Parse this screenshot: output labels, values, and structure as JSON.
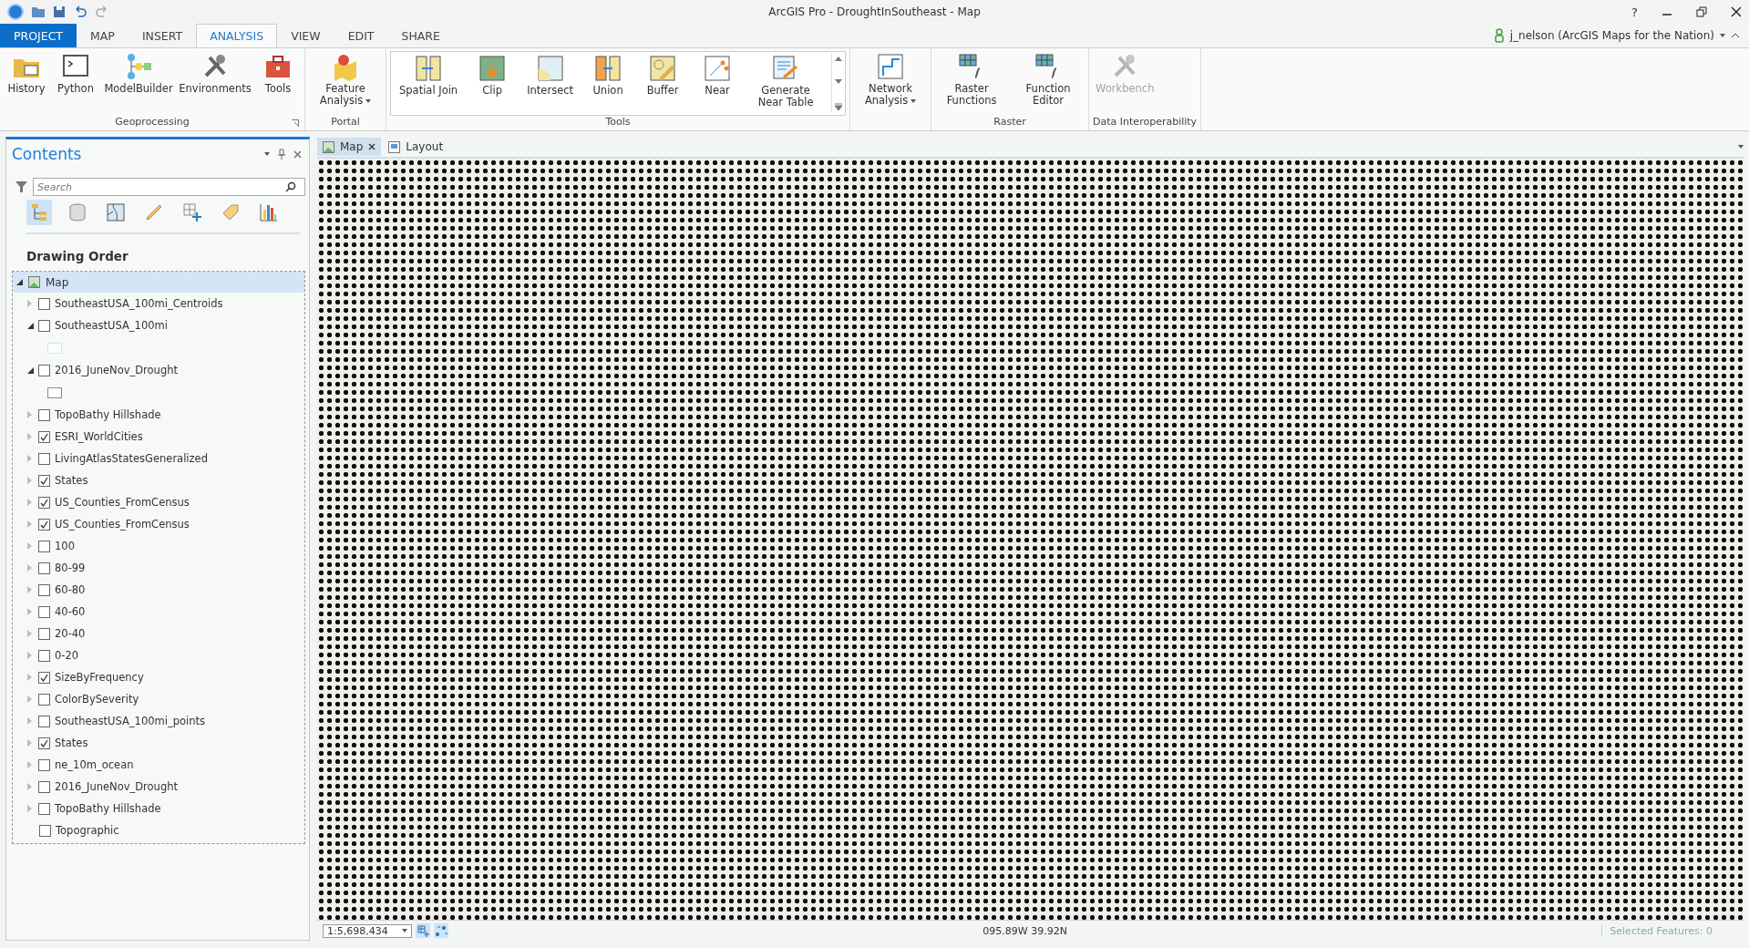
{
  "window": {
    "title": "ArcGIS Pro - DroughtInSoutheast - Map",
    "help": "?"
  },
  "user": {
    "name": "j_nelson (ArcGIS Maps for the Nation)"
  },
  "ribbon_tabs": [
    {
      "label": "PROJECT",
      "kind": "backstage",
      "selected": false
    },
    {
      "label": "MAP",
      "kind": "tab",
      "selected": false
    },
    {
      "label": "INSERT",
      "kind": "tab",
      "selected": false
    },
    {
      "label": "ANALYSIS",
      "kind": "tab",
      "selected": true
    },
    {
      "label": "VIEW",
      "kind": "tab",
      "selected": false
    },
    {
      "label": "EDIT",
      "kind": "tab",
      "selected": false
    },
    {
      "label": "SHARE",
      "kind": "tab",
      "selected": false
    }
  ],
  "ribbon_groups": [
    {
      "label": "Geoprocessing",
      "launcher": true,
      "tools": [
        {
          "label": "History"
        },
        {
          "label": "Python"
        },
        {
          "label": "ModelBuilder"
        },
        {
          "label": "Environments"
        },
        {
          "label": "Tools"
        }
      ]
    },
    {
      "label": "Portal",
      "tools": [
        {
          "label": "Feature Analysis",
          "menu": true
        }
      ]
    },
    {
      "label": "Tools",
      "gallery": true,
      "tools": [
        {
          "label": "Spatial Join"
        },
        {
          "label": "Clip"
        },
        {
          "label": "Intersect"
        },
        {
          "label": "Union"
        },
        {
          "label": "Buffer"
        },
        {
          "label": "Near"
        },
        {
          "label": "Generate Near Table"
        }
      ]
    },
    {
      "tools": [
        {
          "label": "Network Analysis",
          "menu": true
        }
      ]
    },
    {
      "label": "Raster",
      "tools": [
        {
          "label": "Raster Functions"
        },
        {
          "label": "Function Editor"
        }
      ]
    },
    {
      "label": "Data Interoperability",
      "tools": [
        {
          "label": "Workbench",
          "disabled": true
        }
      ]
    }
  ],
  "contents": {
    "title": "Contents",
    "search": {
      "placeholder": "Search"
    },
    "heading": "Drawing Order",
    "layers": [
      {
        "name": "Map",
        "kind": "map",
        "expanded": true,
        "selected": true,
        "children": [
          {
            "name": "SoutheastUSA_100mi_Centroids",
            "kind": "layer",
            "checked": false,
            "expanded": false
          },
          {
            "name": "SoutheastUSA_100mi",
            "kind": "layer",
            "checked": false,
            "expanded": true,
            "color": "#b8f0f4"
          },
          {
            "name": "2016_JuneNov_Drought",
            "kind": "layer",
            "checked": false,
            "expanded": true,
            "color": "#8a8a8a"
          },
          {
            "name": "TopoBathy Hillshade",
            "kind": "layer",
            "checked": false,
            "expanded": false
          },
          {
            "name": "ESRI_WorldCities",
            "kind": "layer",
            "checked": true,
            "expanded": false
          },
          {
            "name": "LivingAtlasStatesGeneralized",
            "kind": "layer",
            "checked": false,
            "expanded": false
          },
          {
            "name": "States",
            "kind": "layer",
            "checked": true,
            "expanded": false
          },
          {
            "name": "US_Counties_FromCensus",
            "kind": "layer",
            "checked": true,
            "expanded": false
          },
          {
            "name": "US_Counties_FromCensus",
            "kind": "layer",
            "checked": true,
            "expanded": false
          },
          {
            "name": "100",
            "kind": "layer",
            "checked": false,
            "expanded": false
          },
          {
            "name": "80-99",
            "kind": "layer",
            "checked": false,
            "expanded": false
          },
          {
            "name": "60-80",
            "kind": "layer",
            "checked": false,
            "expanded": false
          },
          {
            "name": "40-60",
            "kind": "layer",
            "checked": false,
            "expanded": false
          },
          {
            "name": "20-40",
            "kind": "layer",
            "checked": false,
            "expanded": false
          },
          {
            "name": "0-20",
            "kind": "layer",
            "checked": false,
            "expanded": false
          },
          {
            "name": "SizeByFrequency",
            "kind": "layer",
            "checked": true,
            "expanded": false
          },
          {
            "name": "ColorBySeverity",
            "kind": "layer",
            "checked": false,
            "expanded": false
          },
          {
            "name": "SoutheastUSA_100mi_points",
            "kind": "layer",
            "checked": false,
            "expanded": false
          },
          {
            "name": "States",
            "kind": "layer",
            "checked": true,
            "expanded": false
          },
          {
            "name": "ne_10m_ocean",
            "kind": "layer",
            "checked": false,
            "expanded": false
          },
          {
            "name": "2016_JuneNov_Drought",
            "kind": "layer",
            "checked": false,
            "expanded": false
          },
          {
            "name": "TopoBathy Hillshade",
            "kind": "layer",
            "checked": false,
            "expanded": false
          },
          {
            "name": "Topographic",
            "kind": "basemap",
            "checked": false
          }
        ]
      }
    ]
  },
  "view_tabs": [
    {
      "label": "Map",
      "kind": "map",
      "selected": true,
      "closable": true
    },
    {
      "label": "Layout",
      "kind": "layout",
      "selected": false,
      "closable": false
    }
  ],
  "status_bar": {
    "scale": "1:5,698,434",
    "coordinates": "095.89W 39.92N",
    "selected_features": "Selected Features: 0"
  }
}
